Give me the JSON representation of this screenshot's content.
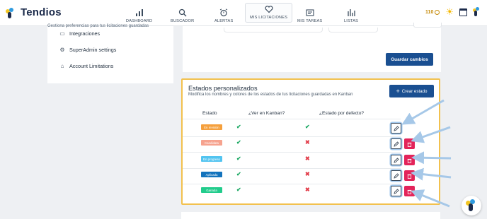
{
  "app": {
    "logo_text": "Tendios"
  },
  "nav": {
    "items": [
      {
        "label": "DASHBOARD",
        "icon": "bar-chart-icon"
      },
      {
        "label": "BUSCADOR",
        "icon": "search-icon"
      },
      {
        "label": "ALERTAS",
        "icon": "alarm-clock-icon"
      },
      {
        "label": "MIS LICITACIONES",
        "icon": "heart-icon",
        "active": true
      },
      {
        "label": "MIS TAREAS",
        "icon": "tasks-icon"
      },
      {
        "label": "LISTAS",
        "icon": "list-chart-icon"
      }
    ]
  },
  "header_tools": {
    "coins": "110"
  },
  "sidebar": {
    "hint": "Gestiona preferencias para tus licitaciones guardadas",
    "items": [
      {
        "label": "Integraciones",
        "icon": "window-icon"
      },
      {
        "label": "SuperAdmin settings",
        "icon": "gear-icon"
      },
      {
        "label": "Account Limitations",
        "icon": "home-icon"
      }
    ]
  },
  "top_card": {
    "save_label": "Guardar cambios"
  },
  "states": {
    "title": "Estados personalizados",
    "subtitle": "Modifica los nombres y colores de los estados de tus licitaciones guardadas en Kanban",
    "create_label": "Crear estado",
    "columns": [
      "Estado",
      "¿Ver en Kanban?",
      "¿Estado por defecto?"
    ],
    "rows": [
      {
        "name": "En revisión",
        "color": "#f5a03d",
        "kanban": true,
        "default": true,
        "deletable": false
      },
      {
        "name": "Candidata",
        "color": "#f6a38f",
        "kanban": true,
        "default": false,
        "deletable": true
      },
      {
        "name": "En progreso",
        "color": "#52c4f0",
        "kanban": true,
        "default": false,
        "deletable": true
      },
      {
        "name": "Aplicada",
        "color": "#1373bd",
        "kanban": true,
        "default": false,
        "deletable": true
      },
      {
        "name": "Ganada",
        "color": "#22cc8c",
        "kanban": true,
        "default": false,
        "deletable": true
      }
    ]
  },
  "colors": {
    "primary": "#1a4f91",
    "highlight": "#f2c14e",
    "delete": "#e3245a",
    "check": "#1aa862",
    "cross": "#e23b48"
  }
}
